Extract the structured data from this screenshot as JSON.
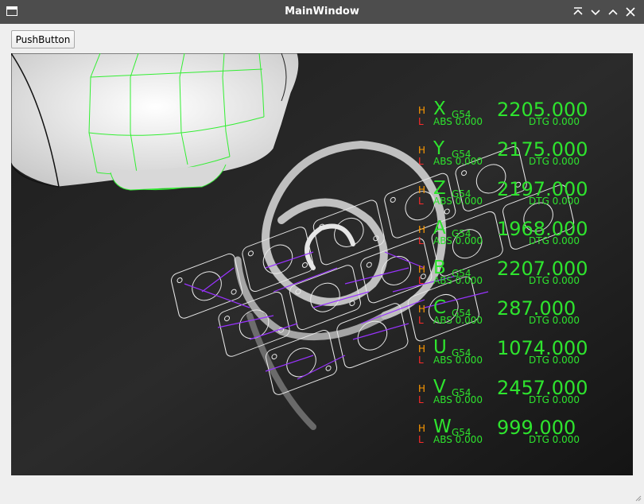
{
  "window": {
    "title": "MainWindow"
  },
  "push_button": {
    "label": "PushButton"
  },
  "dro": {
    "h_label": "H",
    "l_label": "L",
    "rows": [
      {
        "axis": "X",
        "offset": "G54",
        "value": "2205.000",
        "abs": "ABS 0.000",
        "dtg": "DTG 0.000"
      },
      {
        "axis": "Y",
        "offset": "G54",
        "value": "2175.000",
        "abs": "ABS 0.000",
        "dtg": "DTG 0.000"
      },
      {
        "axis": "Z",
        "offset": "G54",
        "value": "2197.000",
        "abs": "ABS 0.000",
        "dtg": "DTG 0.000"
      },
      {
        "axis": "A",
        "offset": "G54",
        "value": "1968.000",
        "abs": "ABS 0.000",
        "dtg": "DTG 0.000"
      },
      {
        "axis": "B",
        "offset": "G54",
        "value": "2207.000",
        "abs": "ABS 0.000",
        "dtg": "DTG 0.000"
      },
      {
        "axis": "C",
        "offset": "G54",
        "value": "287.000",
        "abs": "ABS 0.000",
        "dtg": "DTG 0.000"
      },
      {
        "axis": "U",
        "offset": "G54",
        "value": "1074.000",
        "abs": "ABS 0.000",
        "dtg": "DTG 0.000"
      },
      {
        "axis": "V",
        "offset": "G54",
        "value": "2457.000",
        "abs": "ABS 0.000",
        "dtg": "DTG 0.000"
      },
      {
        "axis": "W",
        "offset": "G54",
        "value": "999.000",
        "abs": "ABS 0.000",
        "dtg": "DTG 0.000"
      }
    ]
  },
  "colors": {
    "titlebar": "#4d4d4d",
    "dro_text": "#2ee42e",
    "home_marker": "#ff9a00",
    "limit_marker": "#ff2a2a",
    "toolpath": "#9933ff",
    "viewport_bg": "#151515"
  },
  "icons": [
    "app-window-icon",
    "keep-above-icon",
    "minimize-icon",
    "maximize-icon",
    "close-icon",
    "resize-grip-icon"
  ]
}
